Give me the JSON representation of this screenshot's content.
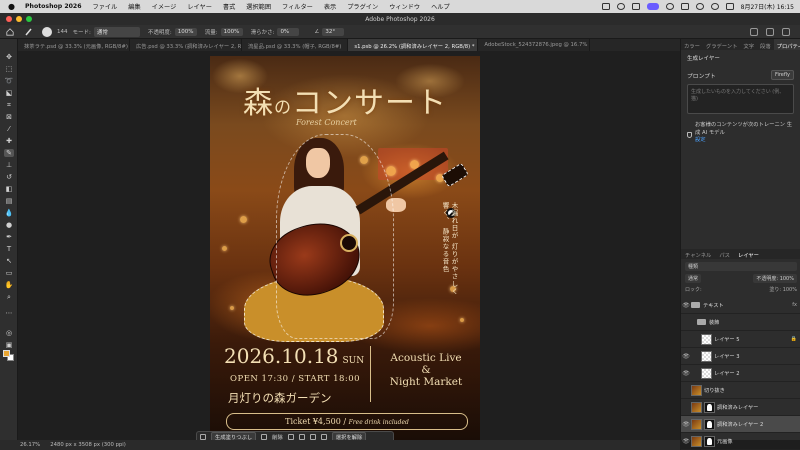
{
  "menubar": {
    "app": "Photoshop 2026",
    "items": [
      "ファイル",
      "編集",
      "イメージ",
      "レイヤー",
      "書式",
      "選択範囲",
      "フィルター",
      "表示",
      "プラグイン",
      "ウィンドウ",
      "ヘルプ"
    ],
    "clock": "8月27日(木) 16:15"
  },
  "window": {
    "title": "Adobe Photoshop 2026"
  },
  "options": {
    "mode_label": "モード:",
    "mode_value": "通常",
    "opacity_label": "不透明度:",
    "opacity_value": "100%",
    "flow_label": "流量:",
    "flow_value": "100%",
    "smoothing_label": "滑らかさ:",
    "smoothing_value": "0%",
    "angle_value": "32°",
    "brush_size": "144"
  },
  "tabs": [
    {
      "label": "抹茶ラテ.psd @ 33.3% (元画像, RGB/8#)"
    },
    {
      "label": "広告.psd @ 33.3% (調和済みレイヤー 2, RGB/8#)"
    },
    {
      "label": "流星品.psd @ 33.3% (帽子, RGB/8#)"
    },
    {
      "label": "s1.psb @ 26.2% (調和済みレイヤー 2, RGB/8) *",
      "active": true
    },
    {
      "label": "AdobeStock_524372876.jpeg @ 16.7% (RGB/8)"
    }
  ],
  "poster": {
    "title_a": "森",
    "title_b": "の",
    "title_c": "コンサート",
    "subtitle": "Forest Concert",
    "vertical_text": "木漏れ日が 灯りがやさしく響く、 静寂なる音色",
    "date": "2026.10.18",
    "weekday": "SUN",
    "open_time": "OPEN 17:30 / START 18:00",
    "venue": "月灯りの森ガーデン",
    "event_line1": "Acoustic Live",
    "event_line2": "&",
    "event_line3": "Night Market",
    "ticket": "Ticket ¥4,500 /",
    "ticket_note": "Free drink included"
  },
  "taskbar": {
    "expand_label": "生成塗りつぶし",
    "remove_label": "削除",
    "deselect_label": "選択を解除"
  },
  "right_panel": {
    "tabs": [
      "カラー",
      "グラデーント",
      "文字",
      "段落",
      "プロパティ"
    ],
    "active_tab": "プロパティ",
    "generative_layer": "生成レイヤー",
    "prompt_label": "プロンプト",
    "model": "Firefly",
    "prompt_placeholder": "生成したいものを入力してください (例、猫)",
    "notice": "お客様のコンテンツが次のトレーニン 生成 AI モデル",
    "notice_link": "設定"
  },
  "layers_panel": {
    "tabs": [
      "チャンネル",
      "パス",
      "レイヤー"
    ],
    "active_tab": "レイヤー",
    "filter": "種類",
    "blend": "通常",
    "opacity": "不透明度: 100%",
    "lock_label": "ロック:",
    "fill": "塗り: 100%",
    "layers": [
      {
        "name": "テキスト",
        "type": "folder",
        "visible": true,
        "fx": "fx"
      },
      {
        "name": "装飾",
        "type": "folder",
        "visible": false
      },
      {
        "name": "レイヤー 5",
        "type": "layer",
        "visible": false,
        "locked": true
      },
      {
        "name": "レイヤー 3",
        "type": "layer",
        "visible": true
      },
      {
        "name": "レイヤー 2",
        "type": "layer",
        "visible": true
      },
      {
        "name": "切り抜き",
        "type": "photo",
        "visible": false
      },
      {
        "name": "調和済みレイヤー",
        "type": "mask",
        "visible": false
      },
      {
        "name": "調和済みレイヤー 2",
        "type": "mask",
        "visible": true,
        "selected": true
      },
      {
        "name": "元画像",
        "type": "mask",
        "visible": true
      }
    ]
  },
  "status": {
    "zoom": "26.17%",
    "dimensions": "2480 px x 3508 px (300 ppi)"
  },
  "colors": {
    "foreground": "#e9a531",
    "background": "#ffffff",
    "accent": "#6a5cff"
  }
}
